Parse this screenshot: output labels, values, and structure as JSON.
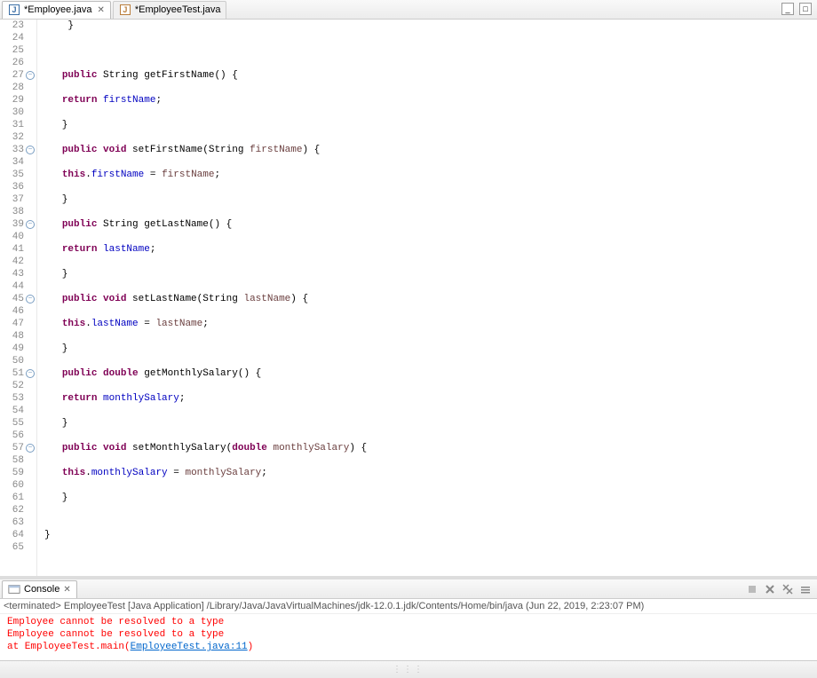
{
  "tabs": [
    {
      "label": "*Employee.java",
      "active": true
    },
    {
      "label": "*EmployeeTest.java",
      "active": false
    }
  ],
  "window_controls": {
    "minimize": "_",
    "maximize": "□"
  },
  "code_lines": [
    {
      "num": 23,
      "fold": false,
      "tokens": [
        [
          "plain",
          "    }"
        ]
      ]
    },
    {
      "num": 24,
      "fold": false,
      "tokens": [
        [
          "plain",
          ""
        ]
      ]
    },
    {
      "num": 25,
      "fold": false,
      "tokens": [
        [
          "plain",
          ""
        ]
      ]
    },
    {
      "num": 26,
      "fold": false,
      "tokens": [
        [
          "plain",
          ""
        ]
      ]
    },
    {
      "num": 27,
      "fold": true,
      "tokens": [
        [
          "plain",
          "   "
        ],
        [
          "kw",
          "public"
        ],
        [
          "plain",
          " String getFirstName() {"
        ]
      ]
    },
    {
      "num": 28,
      "fold": false,
      "tokens": [
        [
          "plain",
          ""
        ]
      ]
    },
    {
      "num": 29,
      "fold": false,
      "tokens": [
        [
          "plain",
          "   "
        ],
        [
          "kw",
          "return"
        ],
        [
          "plain",
          " "
        ],
        [
          "fld",
          "firstName"
        ],
        [
          "plain",
          ";"
        ]
      ]
    },
    {
      "num": 30,
      "fold": false,
      "tokens": [
        [
          "plain",
          ""
        ]
      ]
    },
    {
      "num": 31,
      "fold": false,
      "tokens": [
        [
          "plain",
          "   }"
        ]
      ]
    },
    {
      "num": 32,
      "fold": false,
      "tokens": [
        [
          "plain",
          ""
        ]
      ]
    },
    {
      "num": 33,
      "fold": true,
      "tokens": [
        [
          "plain",
          "   "
        ],
        [
          "kw",
          "public"
        ],
        [
          "plain",
          " "
        ],
        [
          "kw",
          "void"
        ],
        [
          "plain",
          " setFirstName(String "
        ],
        [
          "param",
          "firstName"
        ],
        [
          "plain",
          ") {"
        ]
      ]
    },
    {
      "num": 34,
      "fold": false,
      "tokens": [
        [
          "plain",
          ""
        ]
      ]
    },
    {
      "num": 35,
      "fold": false,
      "tokens": [
        [
          "plain",
          "   "
        ],
        [
          "kw",
          "this"
        ],
        [
          "plain",
          "."
        ],
        [
          "fld",
          "firstName"
        ],
        [
          "plain",
          " = "
        ],
        [
          "param",
          "firstName"
        ],
        [
          "plain",
          ";"
        ]
      ]
    },
    {
      "num": 36,
      "fold": false,
      "tokens": [
        [
          "plain",
          ""
        ]
      ]
    },
    {
      "num": 37,
      "fold": false,
      "tokens": [
        [
          "plain",
          "   }"
        ]
      ]
    },
    {
      "num": 38,
      "fold": false,
      "tokens": [
        [
          "plain",
          ""
        ]
      ]
    },
    {
      "num": 39,
      "fold": true,
      "tokens": [
        [
          "plain",
          "   "
        ],
        [
          "kw",
          "public"
        ],
        [
          "plain",
          " String getLastName() {"
        ]
      ]
    },
    {
      "num": 40,
      "fold": false,
      "tokens": [
        [
          "plain",
          ""
        ]
      ]
    },
    {
      "num": 41,
      "fold": false,
      "tokens": [
        [
          "plain",
          "   "
        ],
        [
          "kw",
          "return"
        ],
        [
          "plain",
          " "
        ],
        [
          "fld",
          "lastName"
        ],
        [
          "plain",
          ";"
        ]
      ]
    },
    {
      "num": 42,
      "fold": false,
      "tokens": [
        [
          "plain",
          ""
        ]
      ]
    },
    {
      "num": 43,
      "fold": false,
      "tokens": [
        [
          "plain",
          "   }"
        ]
      ]
    },
    {
      "num": 44,
      "fold": false,
      "tokens": [
        [
          "plain",
          ""
        ]
      ]
    },
    {
      "num": 45,
      "fold": true,
      "tokens": [
        [
          "plain",
          "   "
        ],
        [
          "kw",
          "public"
        ],
        [
          "plain",
          " "
        ],
        [
          "kw",
          "void"
        ],
        [
          "plain",
          " setLastName(String "
        ],
        [
          "param",
          "lastName"
        ],
        [
          "plain",
          ") {"
        ]
      ]
    },
    {
      "num": 46,
      "fold": false,
      "tokens": [
        [
          "plain",
          ""
        ]
      ]
    },
    {
      "num": 47,
      "fold": false,
      "tokens": [
        [
          "plain",
          "   "
        ],
        [
          "kw",
          "this"
        ],
        [
          "plain",
          "."
        ],
        [
          "fld",
          "lastName"
        ],
        [
          "plain",
          " = "
        ],
        [
          "param",
          "lastName"
        ],
        [
          "plain",
          ";"
        ]
      ]
    },
    {
      "num": 48,
      "fold": false,
      "tokens": [
        [
          "plain",
          ""
        ]
      ]
    },
    {
      "num": 49,
      "fold": false,
      "tokens": [
        [
          "plain",
          "   }"
        ]
      ]
    },
    {
      "num": 50,
      "fold": false,
      "tokens": [
        [
          "plain",
          ""
        ]
      ]
    },
    {
      "num": 51,
      "fold": true,
      "tokens": [
        [
          "plain",
          "   "
        ],
        [
          "kw",
          "public"
        ],
        [
          "plain",
          " "
        ],
        [
          "kw",
          "double"
        ],
        [
          "plain",
          " getMonthlySalary() {"
        ]
      ]
    },
    {
      "num": 52,
      "fold": false,
      "tokens": [
        [
          "plain",
          ""
        ]
      ]
    },
    {
      "num": 53,
      "fold": false,
      "tokens": [
        [
          "plain",
          "   "
        ],
        [
          "kw",
          "return"
        ],
        [
          "plain",
          " "
        ],
        [
          "fld",
          "monthlySalary"
        ],
        [
          "plain",
          ";"
        ]
      ]
    },
    {
      "num": 54,
      "fold": false,
      "tokens": [
        [
          "plain",
          ""
        ]
      ]
    },
    {
      "num": 55,
      "fold": false,
      "tokens": [
        [
          "plain",
          "   }"
        ]
      ]
    },
    {
      "num": 56,
      "fold": false,
      "tokens": [
        [
          "plain",
          ""
        ]
      ]
    },
    {
      "num": 57,
      "fold": true,
      "tokens": [
        [
          "plain",
          "   "
        ],
        [
          "kw",
          "public"
        ],
        [
          "plain",
          " "
        ],
        [
          "kw",
          "void"
        ],
        [
          "plain",
          " setMonthlySalary("
        ],
        [
          "kw",
          "double"
        ],
        [
          "plain",
          " "
        ],
        [
          "param",
          "monthlySalary"
        ],
        [
          "plain",
          ") {"
        ]
      ]
    },
    {
      "num": 58,
      "fold": false,
      "tokens": [
        [
          "plain",
          ""
        ]
      ]
    },
    {
      "num": 59,
      "fold": false,
      "tokens": [
        [
          "plain",
          "   "
        ],
        [
          "kw",
          "this"
        ],
        [
          "plain",
          "."
        ],
        [
          "fld",
          "monthlySalary"
        ],
        [
          "plain",
          " = "
        ],
        [
          "param",
          "monthlySalary"
        ],
        [
          "plain",
          ";"
        ]
      ]
    },
    {
      "num": 60,
      "fold": false,
      "tokens": [
        [
          "plain",
          ""
        ]
      ]
    },
    {
      "num": 61,
      "fold": false,
      "tokens": [
        [
          "plain",
          "   }"
        ]
      ]
    },
    {
      "num": 62,
      "fold": false,
      "tokens": [
        [
          "plain",
          ""
        ]
      ]
    },
    {
      "num": 63,
      "fold": false,
      "tokens": [
        [
          "plain",
          ""
        ]
      ]
    },
    {
      "num": 64,
      "fold": false,
      "tokens": [
        [
          "plain",
          "}"
        ]
      ]
    },
    {
      "num": 65,
      "fold": false,
      "tokens": [
        [
          "plain",
          ""
        ]
      ]
    }
  ],
  "console": {
    "tab_label": "Console",
    "header": "<terminated> EmployeeTest [Java Application] /Library/Java/JavaVirtualMachines/jdk-12.0.1.jdk/Contents/Home/bin/java (Jun 22, 2019, 2:23:07 PM)",
    "lines": [
      {
        "indent": "        ",
        "segments": [
          [
            "err",
            "Employee cannot be resolved to a type"
          ]
        ]
      },
      {
        "indent": "        ",
        "segments": [
          [
            "err",
            "Employee cannot be resolved to a type"
          ]
        ]
      },
      {
        "indent": "",
        "segments": [
          [
            "plain",
            ""
          ]
        ]
      },
      {
        "indent": "        ",
        "segments": [
          [
            "err",
            "at EmployeeTest.main("
          ],
          [
            "link",
            "EmployeeTest.java:11"
          ],
          [
            "err",
            ")"
          ]
        ]
      }
    ]
  }
}
